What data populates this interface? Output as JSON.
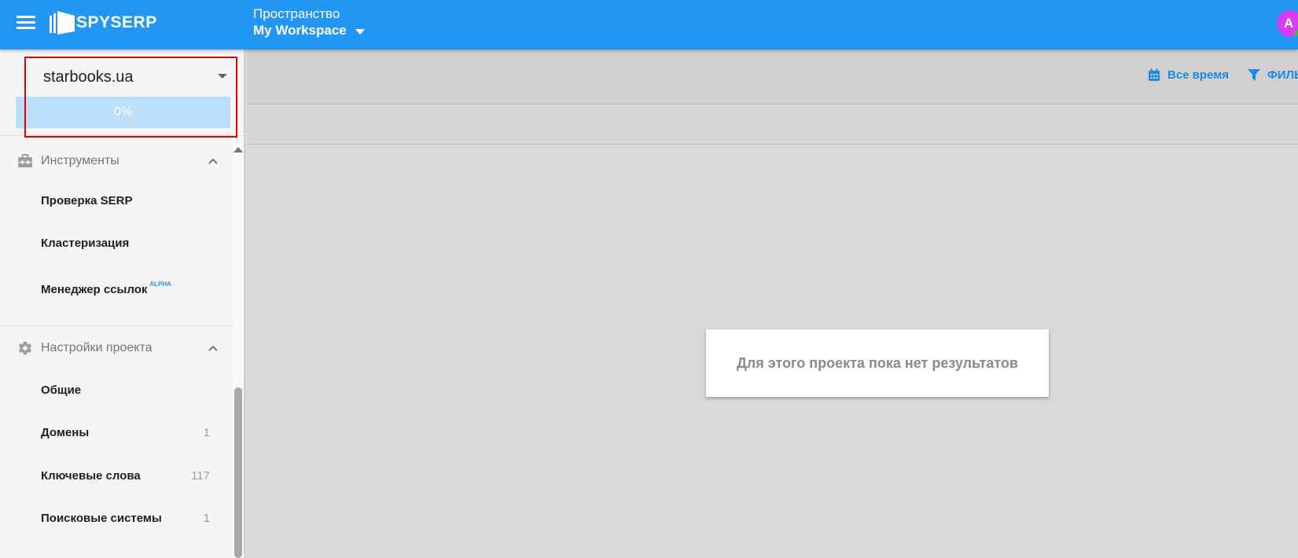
{
  "header": {
    "logo_text": "SPYSERP",
    "workspace_label": "Пространство",
    "workspace_name": "My Workspace",
    "avatar_letter": "A",
    "brand_color": "#2196f3"
  },
  "project": {
    "name": "starbooks.ua",
    "progress_text": "0%",
    "progress_value": 0
  },
  "sidebar": {
    "tools": {
      "title": "Инструменты",
      "icon": "toolbox-icon",
      "items": [
        {
          "label": "Проверка SERP"
        },
        {
          "label": "Кластеризация"
        },
        {
          "label": "Менеджер ссылок",
          "badge": "ALPHA"
        }
      ]
    },
    "settings": {
      "title": "Настройки проекта",
      "icon": "gear-icon",
      "items": [
        {
          "label": "Общие",
          "count": ""
        },
        {
          "label": "Домены",
          "count": "1"
        },
        {
          "label": "Ключевые слова",
          "count": "117"
        },
        {
          "label": "Поисковые системы",
          "count": "1"
        }
      ]
    }
  },
  "toolbar": {
    "period_label": "Все время",
    "period_icon": "calendar-icon",
    "filter_label": "ФИЛЬТР",
    "filter_icon": "filter-icon"
  },
  "main": {
    "empty_message": "Для этого проекта пока нет результатов"
  }
}
